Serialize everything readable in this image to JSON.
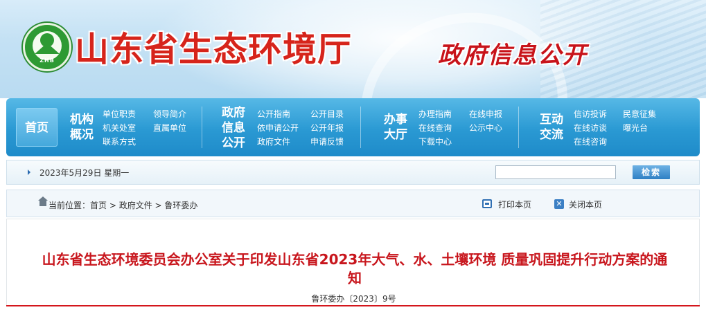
{
  "header": {
    "site_title": "山东省生态环境厅",
    "gov_info_title": "政府信息公开",
    "logo_text": "ZHB"
  },
  "nav": {
    "home": "首页",
    "groups": [
      {
        "title_lines": [
          "机构",
          "概况"
        ],
        "links": [
          "单位职责",
          "领导简介",
          "机关处室",
          "直属单位",
          "联系方式"
        ]
      },
      {
        "title_lines": [
          "政府",
          "信息",
          "公开"
        ],
        "links": [
          "公开指南",
          "公开目录",
          "依申请公开",
          "公开年报",
          "政府文件",
          "申请反馈"
        ]
      },
      {
        "title_lines": [
          "办事",
          "大厅"
        ],
        "links": [
          "办理指南",
          "在线申报",
          "在线查询",
          "公示中心",
          "下载中心"
        ]
      },
      {
        "title_lines": [
          "互动",
          "交流"
        ],
        "links": [
          "信访投诉",
          "民意征集",
          "在线访谈",
          "曝光台",
          "在线咨询"
        ]
      }
    ]
  },
  "toolbar": {
    "date": "2023年5月29日 星期一",
    "search_value": "",
    "search_button": "检索"
  },
  "breadcrumb": {
    "label": "当前位置：",
    "items": [
      "首页",
      "政府文件",
      "鲁环委办"
    ],
    "separator": " > ",
    "print": "打印本页",
    "close": "关闭本页"
  },
  "document": {
    "title_line1": "山东省生态环境委员会办公室关于印发山东省2023年大气、水、土壤环境 质量巩固提升行动方案的通",
    "title_line2": "知",
    "doc_number": "鲁环委办〔2023〕9号"
  },
  "colors": {
    "title_red": "#d6241b",
    "nav_blue": "#2a99d3",
    "doc_title_red": "#c8161d"
  }
}
